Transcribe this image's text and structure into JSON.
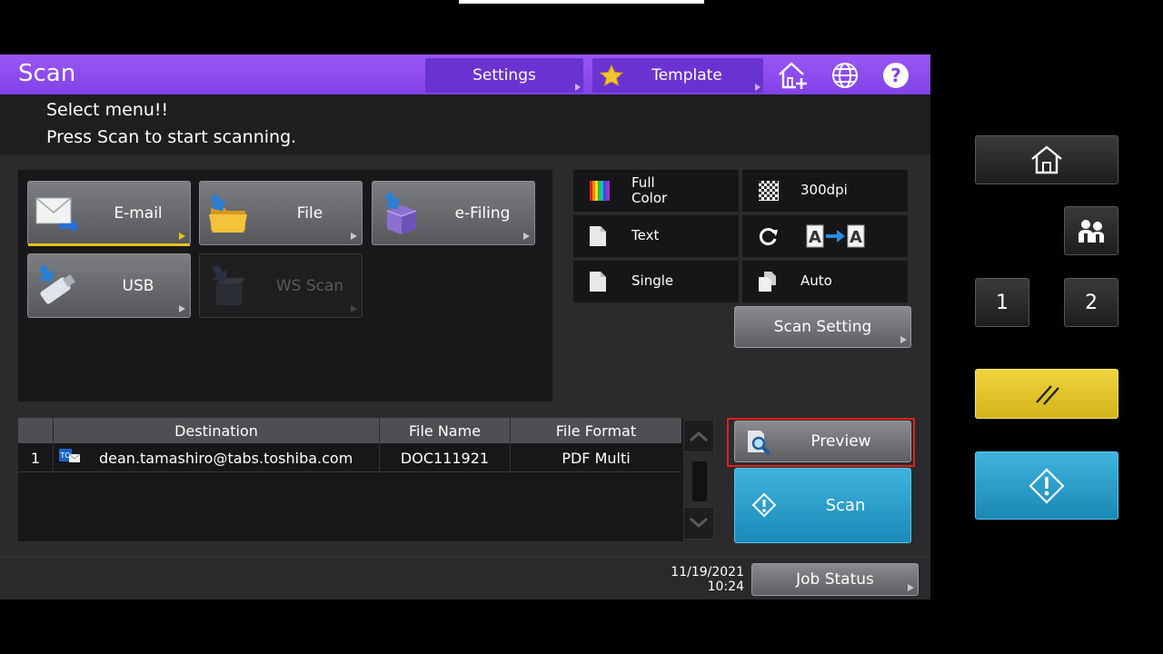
{
  "titlebar": {
    "title": "Scan",
    "settings_label": "Settings",
    "template_label": "Template",
    "icons": [
      "star-icon",
      "home-plus-icon",
      "globe-icon",
      "help-icon"
    ]
  },
  "message": {
    "line1": "Select menu!!",
    "line2": "Press Scan to start scanning."
  },
  "menu": {
    "email": "E-mail",
    "file": "File",
    "efiling": "e-Filing",
    "usb": "USB",
    "wsscan": "WS Scan"
  },
  "settings": {
    "color": "Full Color",
    "color_line1": "Full",
    "color_line2": "Color",
    "resolution": "300dpi",
    "mode": "Text",
    "rotation": "A→A",
    "sides": "Single",
    "size": "Auto",
    "scan_setting": "Scan Setting"
  },
  "table": {
    "headers": [
      "Destination",
      "File Name",
      "File Format"
    ],
    "rows": [
      {
        "num": "1",
        "destination": "dean.tamashiro@tabs.toshiba.com",
        "file_name": "DOC111921",
        "file_format": "PDF Multi"
      }
    ]
  },
  "actions": {
    "preview": "Preview",
    "scan": "Scan",
    "job_status": "Job Status"
  },
  "status": {
    "date": "11/19/2021",
    "time": "10:24"
  },
  "side_panel": {
    "btn1": "1",
    "btn2": "2"
  },
  "colors": {
    "titlebar": "#8f4cf0",
    "scan_button": "#2aa0cf",
    "clear_button": "#e3c52b",
    "highlight": "#e0201b"
  }
}
